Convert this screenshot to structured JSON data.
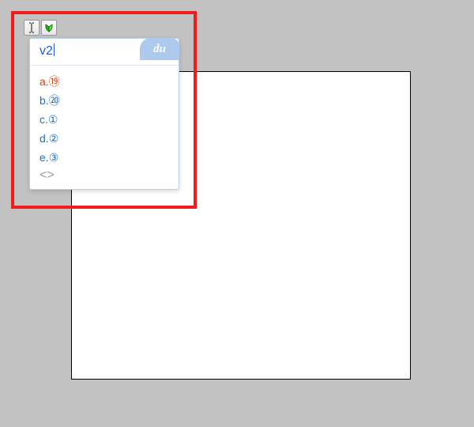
{
  "toolbar": {
    "cursor_tool": "text-cursor-icon",
    "arrow_tool": "insert-arrow-icon"
  },
  "ime": {
    "brand": "du",
    "input": "v2",
    "candidates": [
      {
        "key": "a.",
        "value": "⑲",
        "selected": true
      },
      {
        "key": "b.",
        "value": "⑳",
        "selected": false
      },
      {
        "key": "c.",
        "value": "①",
        "selected": false
      },
      {
        "key": "d.",
        "value": "②",
        "selected": false
      },
      {
        "key": "e.",
        "value": "③",
        "selected": false
      }
    ],
    "more": "<>"
  }
}
